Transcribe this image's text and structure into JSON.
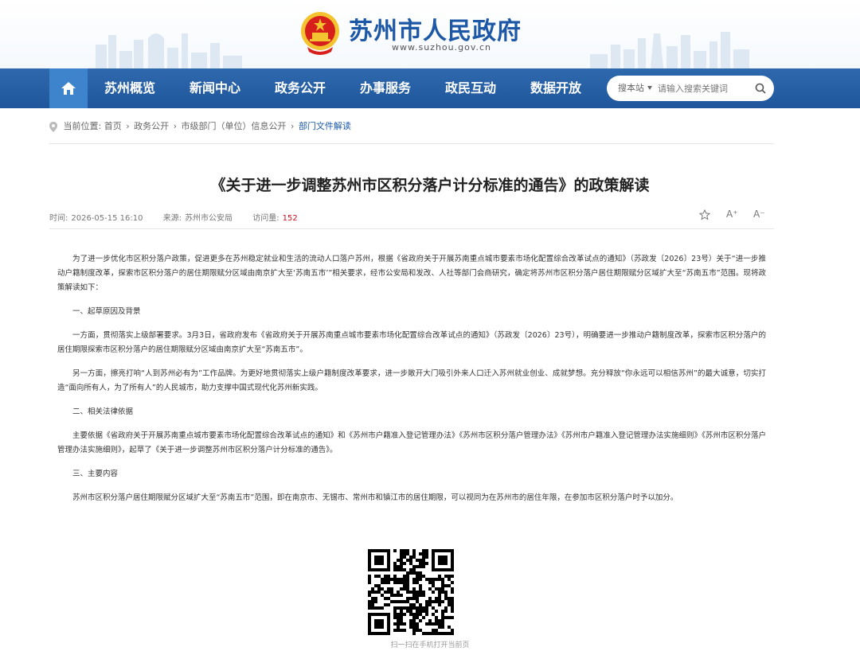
{
  "header": {
    "site_name": "苏州市人民政府",
    "site_url": "www.suzhou.gov.cn"
  },
  "nav": {
    "home_icon": "home-icon",
    "items": [
      "苏州概览",
      "新闻中心",
      "政务公开",
      "办事服务",
      "政民互动",
      "数据开放"
    ],
    "search_station": "搜本站",
    "search_placeholder": "请输入搜索关键词"
  },
  "breadcrumb": {
    "prefix": "当前位置:",
    "items": [
      "首页",
      "政务公开",
      "市级部门（单位）信息公开",
      "部门文件解读"
    ],
    "sep": "›"
  },
  "article": {
    "title": "《关于进一步调整苏州市区积分落户计分标准的通告》的政策解读",
    "time_label": "时间:",
    "time": "2026-05-15 16:10",
    "source_label": "来源:",
    "source": "苏州市公安局",
    "views_label": "访问量:",
    "views": "152",
    "font_up": "A⁺",
    "font_down": "A⁻",
    "paragraphs": [
      "为了进一步优化市区积分落户政策，促进更多在苏州稳定就业和生活的流动人口落户苏州，根据《省政府关于开展苏南重点城市要素市场化配置综合改革试点的通知》（苏政发〔2026〕23号）关于“进一步推动户籍制度改革，探索市区积分落户的居住期限赋分区域由南京扩大至‘苏南五市’”相关要求，经市公安局和发改、人社等部门会商研究，确定将苏州市区积分落户居住期限赋分区域扩大至“苏南五市”范围。现将政策解读如下：",
      "一、起草原因及背景",
      "一方面，贯彻落实上级部署要求。3月3日，省政府发布《省政府关于开展苏南重点城市要素市场化配置综合改革试点的通知》（苏政发〔2026〕23号），明确要进一步推动户籍制度改革，探索市区积分落户的居住期限探索市区积分落户的居住期限赋分区域由南京扩大至“苏南五市”。",
      "另一方面，擦亮打响“人到苏州必有为”工作品牌。为更好地贯彻落实上级户籍制度改革要求，进一步敞开大门吸引外来人口迁入苏州就业创业、成就梦想。充分释放“你永远可以相信苏州”的最大诚意，切实打造“面向所有人，为了所有人”的人民城市，助力支撑中国式现代化苏州新实践。",
      "二、相关法律依据",
      "主要依据《省政府关于开展苏南重点城市要素市场化配置综合改革试点的通知》和《苏州市户籍准入登记管理办法》《苏州市区积分落户管理办法》《苏州市户籍准入登记管理办法实施细则》《苏州市区积分落户管理办法实施细则》，起草了《关于进一步调整苏州市区积分落户计分标准的通告》。",
      "三、主要内容",
      "苏州市区积分落户居住期限赋分区域扩大至“苏南五市”范围，即在南京市、无锡市、常州市和镇江市的居住期限，可以视同为在苏州市的居住年限，在参加市区积分落户时予以加分。"
    ],
    "qr_caption": "扫一扫在手机打开当前页"
  },
  "colors": {
    "brand_blue": "#1d58a6",
    "nav_bg": "#2a62a6",
    "home_bg": "#3d84cc",
    "views_red": "#c12"
  }
}
